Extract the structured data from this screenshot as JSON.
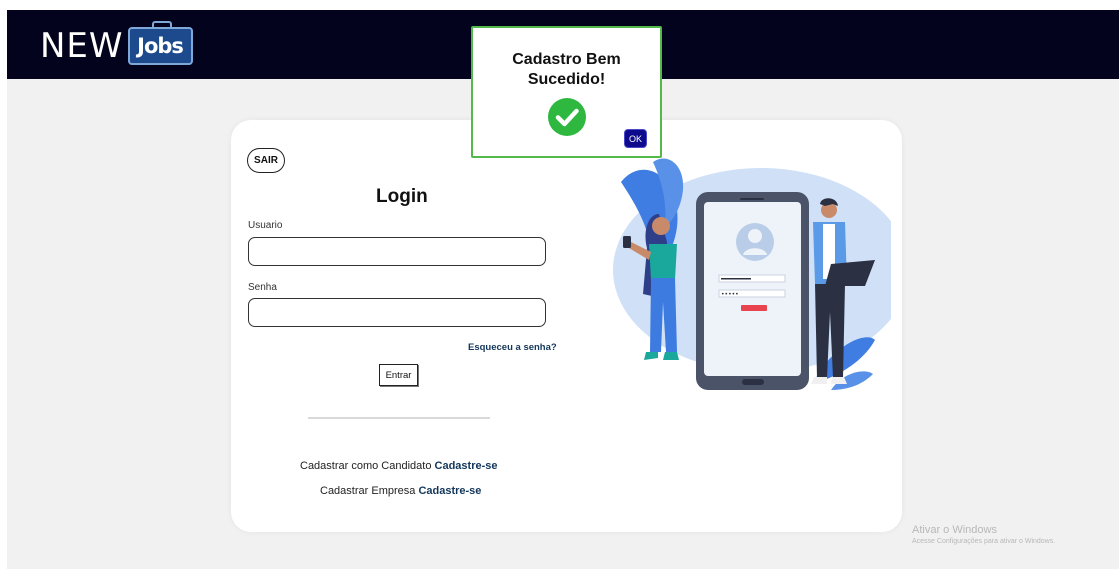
{
  "header": {
    "logo_new": "NEW",
    "logo_jobs": "Jobs"
  },
  "login": {
    "sair_label": "SAIR",
    "title": "Login",
    "usuario_label": "Usuario",
    "usuario_value": "",
    "senha_label": "Senha",
    "senha_value": "",
    "forgot_label": "Esqueceu a senha?",
    "entrar_label": "Entrar",
    "candidate_text": "Cadastrar como Candidato",
    "candidate_link": "Cadastre-se",
    "company_text": "Cadastrar Empresa",
    "company_link": "Cadastre-se"
  },
  "illustration": {
    "icons": [
      "person-with-phone",
      "tablet-user-profile",
      "person-with-laptop",
      "leaf"
    ]
  },
  "dialog": {
    "title_line1": "Cadastro Bem",
    "title_line2": "Sucedido!",
    "ok_label": "OK",
    "icon": "check-circle-icon",
    "success_color": "#2eb83f",
    "border_color": "#53b94a",
    "ok_color": "#0d0a8c"
  },
  "watermark": {
    "title": "Ativar o Windows",
    "subtitle": "Acesse Configurações para ativar o Windows."
  },
  "colors": {
    "header": "#03031d",
    "background": "#f1f1f1",
    "link": "#13375a"
  }
}
